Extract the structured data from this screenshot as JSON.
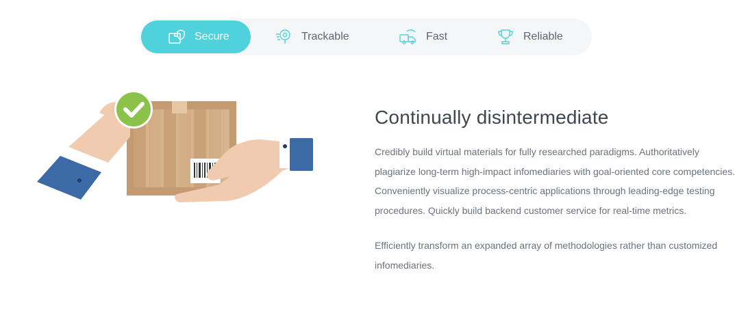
{
  "tabs": [
    {
      "label": "Secure",
      "icon": "box-shield-icon",
      "active": true
    },
    {
      "label": "Trackable",
      "icon": "location-pin-icon",
      "active": false
    },
    {
      "label": "Fast",
      "icon": "fast-delivery-icon",
      "active": false
    },
    {
      "label": "Reliable",
      "icon": "trophy-icon",
      "active": false
    }
  ],
  "content": {
    "heading": "Continually disintermediate",
    "paragraph_1": "Credibly build virtual materials for fully researched paradigms. Authoritatively plagiarize long-term high-impact infomediaries with goal-oriented core competencies. Conveniently visualize process-centric applications through leading-edge testing procedures. Quickly build backend customer service for real-time metrics.",
    "paragraph_2": "Efficiently transform an expanded array of methodologies rather than customized infomediaries."
  },
  "colors": {
    "accent": "#4fd2db",
    "tab_bar_bg": "#f4f6f8",
    "heading": "#3f4650",
    "body_text": "#6b727d",
    "check_green": "#8bc34a",
    "sleeve_blue": "#3b6aa6",
    "box_brown": "#c49a72"
  }
}
